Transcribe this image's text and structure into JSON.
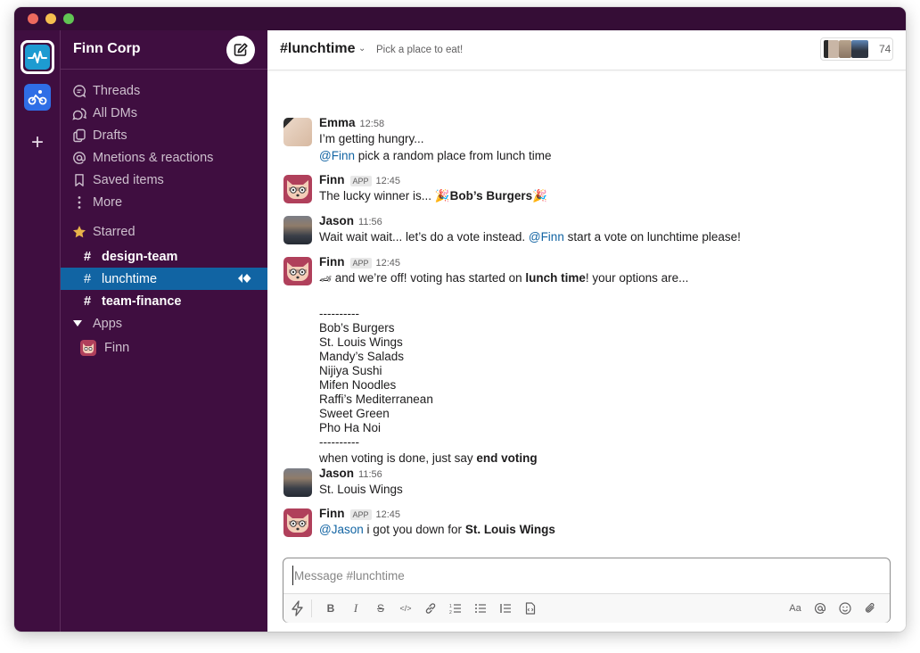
{
  "window": {
    "workspace_name": "Finn Corp"
  },
  "sidebar": {
    "nav_items": [
      {
        "label": "Threads",
        "icon": "threads-icon"
      },
      {
        "label": "All DMs",
        "icon": "dms-icon"
      },
      {
        "label": "Drafts",
        "icon": "drafts-icon"
      },
      {
        "label": "Mnetions & reactions",
        "icon": "at-icon"
      },
      {
        "label": "Saved items",
        "icon": "bookmark-icon"
      },
      {
        "label": "More",
        "icon": "more-vertical-icon"
      }
    ],
    "starred_label": "Starred",
    "channels": [
      {
        "name": "design-team",
        "active": false
      },
      {
        "name": "lunchtime",
        "active": true
      },
      {
        "name": "team-finance",
        "active": false
      }
    ],
    "apps_label": "Apps",
    "apps": [
      {
        "name": "Finn"
      }
    ],
    "hash": "#"
  },
  "channel": {
    "name": "#lunchtime",
    "topic": "Pick a place to eat!",
    "member_count": "74"
  },
  "messages": [
    {
      "author": "Emma",
      "time": "12:58",
      "lines": [
        "I’m getting hungry..."
      ],
      "mention_line": {
        "mention": "@Finn",
        "text": " pick a random place from lunch time"
      }
    },
    {
      "author": "Finn",
      "app_tag": "APP",
      "time": "12:45",
      "pre": "The lucky winner is... ",
      "bold": "Bob’s Burgers",
      "emoji": "🎉"
    },
    {
      "author": "Jason",
      "time": "11:56",
      "pre": "Wait wait wait... let’s do a vote instead. ",
      "mention": "@Finn",
      "post": " start a vote on lunchtime please!"
    },
    {
      "author": "Finn",
      "app_tag": "APP",
      "time": "12:45",
      "emoji": "🏎",
      "pre": " and we’re off! voting has started on ",
      "bold": "lunch time",
      "post": "! your options are...",
      "divider": "----------",
      "options": [
        "Bob’s Burgers",
        "St. Louis Wings",
        "Mandy’s Salads",
        "Nijiya Sushi",
        "Mifen Noodles",
        "Raffi’s Mediterranean",
        "Sweet Green",
        "Pho Ha Noi"
      ],
      "footer_pre": "when voting is done, just say ",
      "footer_bold": "end voting"
    },
    {
      "author": "Jason",
      "time": "11:56",
      "text": "St. Louis Wings"
    },
    {
      "author": "Finn",
      "app_tag": "APP",
      "time": "12:45",
      "mention": "@Jason",
      "pre": " i got you down for ",
      "bold": "St. Louis Wings"
    }
  ],
  "composer": {
    "placeholder": "Message #lunchtime",
    "value": "",
    "format_buttons": [
      "shortcuts",
      "bold",
      "italic",
      "strikethrough",
      "code",
      "link",
      "ordered-list",
      "bulleted-list",
      "blockquote",
      "code-block"
    ],
    "right_buttons": [
      "formatting",
      "mention",
      "emoji",
      "attach"
    ],
    "bold_label": "B",
    "italic_label": "I",
    "strike_label": "S",
    "code_label": "</>",
    "aa_label": "Aa"
  },
  "colors": {
    "sidebar_bg": "#3f0e40",
    "active_channel": "#1164a3",
    "mention": "#1264a3",
    "titlebar": "#350d36"
  }
}
